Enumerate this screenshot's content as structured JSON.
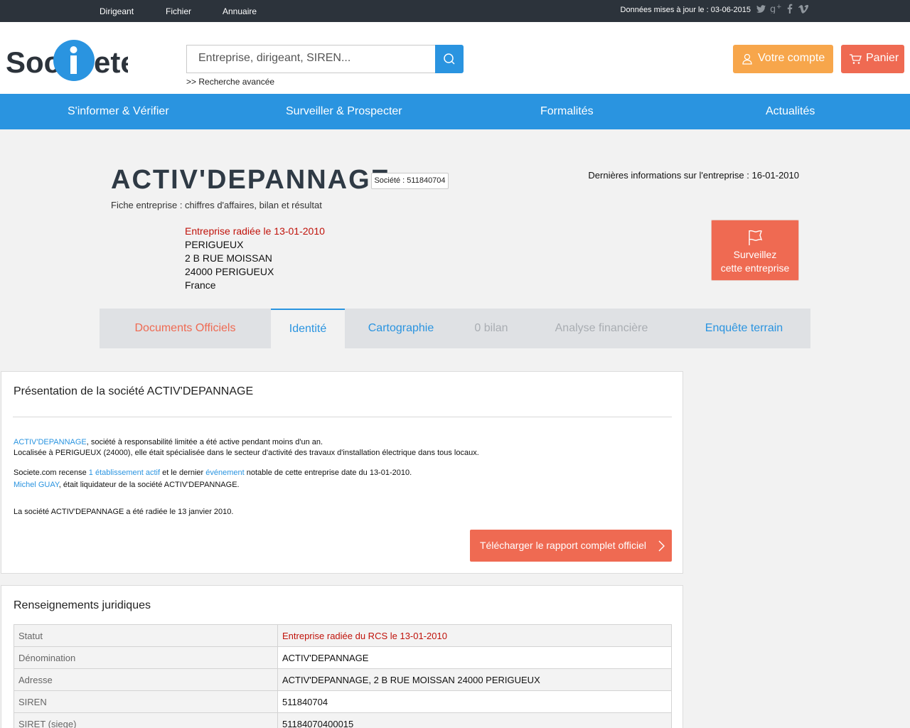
{
  "topbar": {
    "links": [
      "Dirigeant",
      "Fichier",
      "Annuaire"
    ],
    "updated": "Données mises à jour le : 03-06-2015"
  },
  "header": {
    "logo_text": "Societe",
    "search_placeholder": "Entreprise, dirigeant, SIREN...",
    "advanced_search": ">> Recherche avancée",
    "account_label": "Votre compte",
    "cart_label": "Panier",
    "colors": {
      "blue": "#2a94e0",
      "orange": "#f7a64b",
      "red": "#ef6a52"
    }
  },
  "mainnav": [
    "S'informer & Vérifier",
    "Surveiller & Prospecter",
    "Formalités",
    "Actualités"
  ],
  "company": {
    "name": "ACTIV'DEPANNAGE",
    "badge": "Société : 511840704",
    "subtitle": "Fiche entreprise : chiffres d'affaires, bilan et résultat",
    "last_info": "Dernières informations sur l'entreprise : 16-01-2010",
    "status": "Entreprise radiée le 13-01-2010",
    "address_lines": [
      "PERIGUEUX",
      "2 B RUE MOISSAN",
      "24000 PERIGUEUX",
      "France"
    ],
    "watch_line1": "Surveillez",
    "watch_line2": "cette entreprise"
  },
  "tabs": [
    {
      "label": "Documents Officiels",
      "color": "#ef6a52"
    },
    {
      "label": "Identité",
      "color": "#2a94e0"
    },
    {
      "label": "Cartographie",
      "color": "#2a94e0"
    },
    {
      "label": "0 bilan",
      "color": "#a9adb2"
    },
    {
      "label": "Analyse financière",
      "color": "#a9adb2"
    },
    {
      "label": "Enquête terrain",
      "color": "#2a94e0"
    }
  ],
  "presentation": {
    "title": "Présentation de la société ACTIV'DEPANNAGE",
    "p1_link": "ACTIV'DEPANNAGE",
    "p1_rest": ", société à responsabilité limitée a été active pendant moins d'un an.",
    "p2": "Localisée à PERIGUEUX (24000), elle était spécialisée dans le secteur d'activité des travaux d'installation électrique dans tous locaux.",
    "p3_a": "Societe.com recense ",
    "p3_link1": "1 établissement actif",
    "p3_b": " et le dernier ",
    "p3_link2": "événement",
    "p3_c": " notable de cette entreprise date du 13-01-2010.",
    "p4_link": "Michel GUAY",
    "p4_rest": ", était liquidateur de la société ACTIV'DEPANNAGE.",
    "p5": "La société ACTIV'DEPANNAGE a été radiée le 13 janvier 2010.",
    "download": "Télécharger le rapport complet officiel"
  },
  "juridique": {
    "title": "Renseignements juridiques",
    "rows": [
      {
        "k": "Statut",
        "v": "Entreprise radiée du RCS le 13-01-2010"
      },
      {
        "k": "Dénomination",
        "v": "ACTIV'DEPANNAGE"
      },
      {
        "k": "Adresse",
        "v": "ACTIV'DEPANNAGE, 2 B RUE MOISSAN 24000 PERIGUEUX"
      },
      {
        "k": "SIREN",
        "v": "511840704"
      },
      {
        "k": "SIRET (siege)",
        "v": "51184070400015"
      }
    ]
  }
}
